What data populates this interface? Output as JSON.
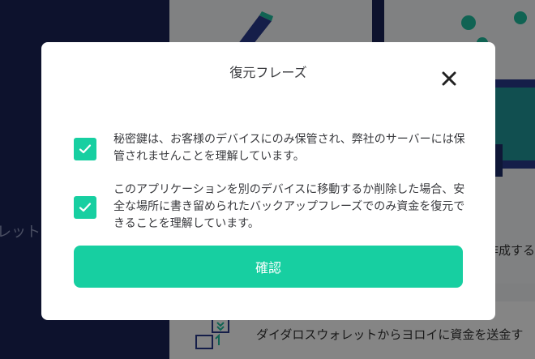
{
  "background": {
    "sidebar_text": "レット",
    "card_text": "作成する",
    "row_text": "ダイダロスウォレットからヨロイに資金を送金す"
  },
  "modal": {
    "title": "復元フレーズ",
    "checkboxes": [
      {
        "checked": true,
        "label": "秘密鍵は、お客様のデバイスにのみ保管され、弊社のサーバーには保管されませんことを理解しています。"
      },
      {
        "checked": true,
        "label": "このアプリケーションを別のデバイスに移動するか削除した場合、安全な場所に書き留められたバックアップフレーズでのみ資金を復元できることを理解しています。"
      }
    ],
    "confirm_label": "確認"
  },
  "colors": {
    "accent": "#17cfa1",
    "sidebar": "#1a2456",
    "overlay": "rgba(0,0,0,0.48)",
    "text": "#38393d"
  },
  "icons": [
    "close-icon",
    "checkmark-icon",
    "transfer-icon"
  ]
}
